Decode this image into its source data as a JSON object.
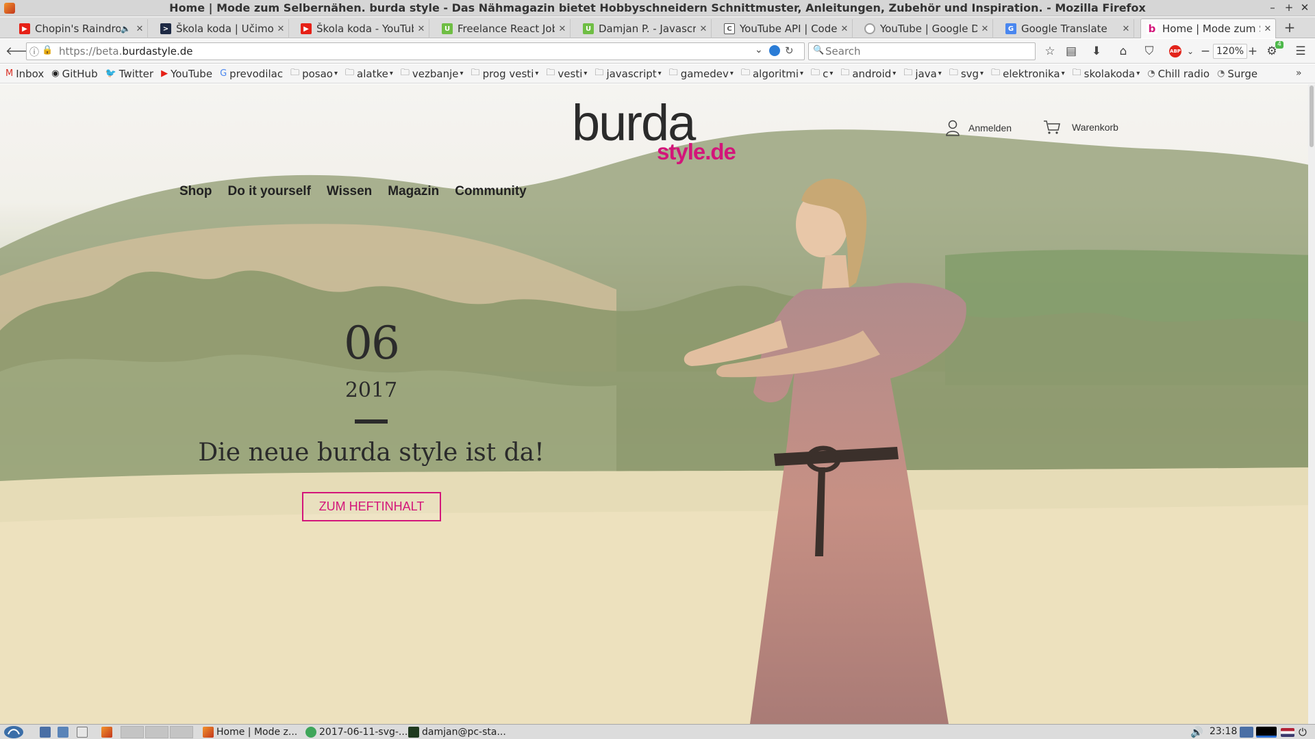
{
  "window": {
    "title": "Home | Mode zum Selbernähen. burda style - Das Nähmagazin bietet Hobbyschneidern Schnittmuster, Anleitungen, Zubehör und Inspiration. - Mozilla Firefox",
    "controls": [
      "–",
      "+",
      "✕"
    ]
  },
  "tabs": [
    {
      "label": "Chopin's Raindrop",
      "icon": "youtube-icon",
      "color": "#e62117",
      "audio": true
    },
    {
      "label": "Škola koda | Učimo na",
      "icon": "terminal-icon",
      "color": "#1e2a44"
    },
    {
      "label": "Škola koda - YouTube",
      "icon": "youtube-icon",
      "color": "#e62117"
    },
    {
      "label": "Freelance React Jobs",
      "icon": "upwork-icon",
      "color": "#6fbe44"
    },
    {
      "label": "Damjan P. - Javascript",
      "icon": "upwork-icon",
      "color": "#6fbe44"
    },
    {
      "label": "YouTube API | Codeca",
      "icon": "document-icon",
      "color": "#555555"
    },
    {
      "label": "YouTube  |  Google De",
      "icon": "google-dev-icon",
      "color": "#9e9e9e"
    },
    {
      "label": "Google Translate",
      "icon": "google-translate-icon",
      "color": "#4a87ef"
    },
    {
      "label": "Home | Mode zum Sel",
      "icon": "burda-icon",
      "color": "#d3157a",
      "active": true
    }
  ],
  "navbar": {
    "url_prefix": "https://beta.",
    "url_domain": "burdastyle.de",
    "search_placeholder": "Search",
    "zoom": "120%",
    "badge_count": "4",
    "abp_label": "ABP"
  },
  "bookmarks": [
    {
      "label": "Inbox",
      "icon": "gmail-icon",
      "color": "#d93025"
    },
    {
      "label": "GitHub",
      "icon": "github-icon",
      "color": "#222222"
    },
    {
      "label": "Twitter",
      "icon": "twitter-icon",
      "color": "#1da1f2"
    },
    {
      "label": "YouTube",
      "icon": "youtube-icon",
      "color": "#e62117"
    },
    {
      "label": "prevodilac",
      "icon": "google-translate-icon",
      "color": "#4a87ef"
    },
    {
      "label": "posao",
      "folder": true
    },
    {
      "label": "alatke",
      "folder": true
    },
    {
      "label": "vezbanje",
      "folder": true
    },
    {
      "label": "prog vesti",
      "folder": true
    },
    {
      "label": "vesti",
      "folder": true
    },
    {
      "label": "javascript",
      "folder": true
    },
    {
      "label": "gamedev",
      "folder": true
    },
    {
      "label": "algoritmi",
      "folder": true
    },
    {
      "label": "c",
      "folder": true
    },
    {
      "label": "android",
      "folder": true
    },
    {
      "label": "java",
      "folder": true
    },
    {
      "label": "svg",
      "folder": true
    },
    {
      "label": "elektronika",
      "folder": true
    },
    {
      "label": "skolakoda",
      "folder": true
    },
    {
      "label": "Chill radio",
      "icon": "radio-icon",
      "color": "#666666"
    },
    {
      "label": "Surge",
      "icon": "radio-icon",
      "color": "#666666"
    }
  ],
  "site": {
    "logo_main": "burda",
    "logo_sub": "style.de",
    "account_label": "Anmelden",
    "cart_label": "Warenkorb",
    "nav": [
      "Shop",
      "Do it yourself",
      "Wissen",
      "Magazin",
      "Community"
    ],
    "issue_number": "06",
    "issue_year": "2017",
    "headline": "Die neue burda style ist da!",
    "cta_label": "ZUM HEFTINHALT",
    "accent_color": "#d3157a"
  },
  "taskbar": {
    "windows": [
      {
        "label": "Home | Mode z...",
        "icon": "firefox-icon"
      },
      {
        "label": "2017-06-11-svg-...",
        "icon": "image-viewer-icon"
      },
      {
        "label": "damjan@pc-sta...",
        "icon": "terminal-icon"
      }
    ],
    "clock": "23:18"
  }
}
